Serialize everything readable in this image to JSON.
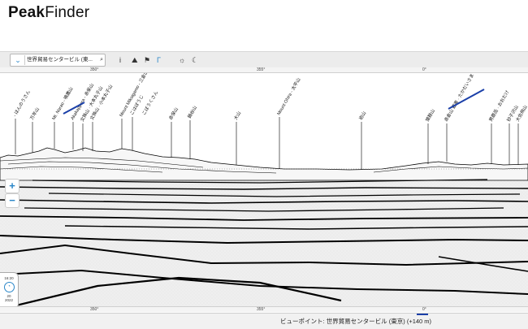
{
  "app": {
    "brand_bold": "Peak",
    "brand_light": "Finder"
  },
  "toolbar": {
    "location": "世界貿易センタービル (東...",
    "icons": [
      "info-icon",
      "binoculars-icon",
      "hiker-icon",
      "compass-icon",
      "sun-icon",
      "moon-icon"
    ],
    "icon_glyphs": [
      "ℹ",
      "⛰",
      "⚑",
      "⌐",
      "☼",
      "☾"
    ]
  },
  "ruler": {
    "top_ticks": [
      "350°",
      "355°",
      "0°"
    ],
    "bottom_ticks": [
      "350°",
      "355°",
      "0°"
    ]
  },
  "peaks": [
    "- ほんのうさん",
    "万年山",
    "Mt. Narao - 鳴鷹山",
    "Aka­kappara - 赤柴山",
    "文殊山 · 大本丸子山",
    "文殊山 · 小本丸子山",
    "Mount Mikaigamo - 三倉山",
    "こはぼうじ",
    "こぼうくさん",
    "赤保山",
    "鍋谷山",
    "大山",
    "Mount Ohira - 太平山",
    "岩山",
    "猿鞍山",
    "赤倉山 要害 · たかだいさま",
    "男鹿岳 · おおだけ",
    "砂子沢山",
    "大佐飛山"
  ],
  "controls": {
    "zoom_in": "+",
    "zoom_out": "−"
  },
  "time": {
    "time": "16:20",
    "day": "20",
    "year": "2022"
  },
  "status": {
    "viewpoint": "ビューポイント: 世界貿易センタービル (東京) (+140 m)"
  }
}
